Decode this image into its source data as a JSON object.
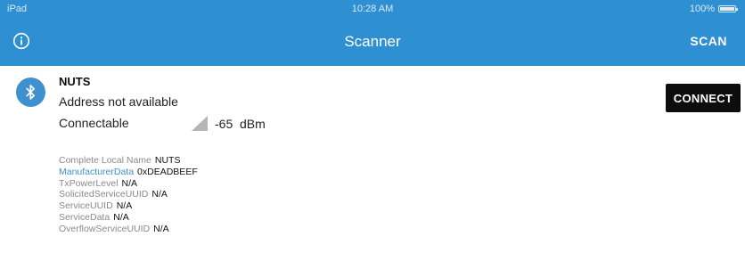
{
  "status_bar": {
    "carrier": "iPad",
    "time": "10:28 AM",
    "battery": "100%",
    "battery_level": 1.0
  },
  "nav": {
    "title": "Scanner",
    "info_icon": "info-circle-icon",
    "scan_label": "SCAN"
  },
  "device": {
    "icon": "bluetooth-icon",
    "name": "NUTS",
    "address": "Address not available",
    "connectable": "Connectable",
    "rssi_icon": "signal-strength-icon",
    "rssi": "-65",
    "rssi_unit": "dBm",
    "connect_label": "CONNECT",
    "advertisement": [
      {
        "key": "Complete Local Name",
        "value": "NUTS",
        "highlight": false
      },
      {
        "key": "ManufacturerData",
        "value": "0xDEADBEEF",
        "highlight": true
      },
      {
        "key": "TxPowerLevel",
        "value": "N/A",
        "highlight": false
      },
      {
        "key": "SolicitedServiceUUID",
        "value": "N/A",
        "highlight": false
      },
      {
        "key": "ServiceUUID",
        "value": "N/A",
        "highlight": false
      },
      {
        "key": "ServiceData",
        "value": "N/A",
        "highlight": false
      },
      {
        "key": "OverflowServiceUUID",
        "value": "N/A",
        "highlight": false
      }
    ]
  },
  "colors": {
    "header": "#2f8fd3",
    "accent": "#3e90cf",
    "connect_button": "#0d0d0d"
  }
}
